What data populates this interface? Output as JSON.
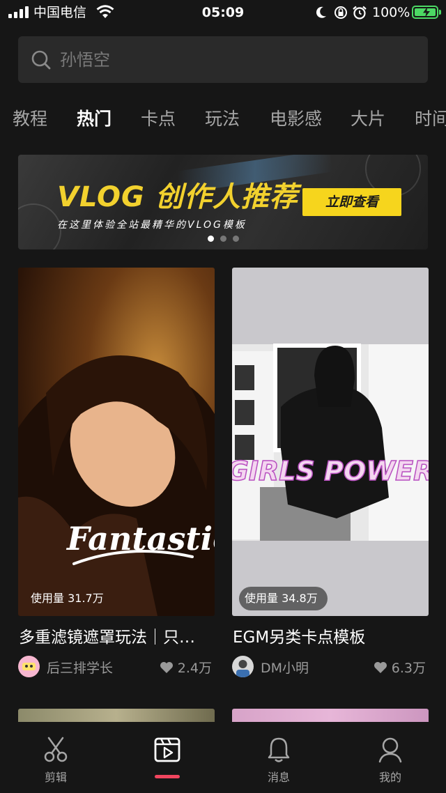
{
  "status_bar": {
    "carrier": "中国电信",
    "time": "05:09",
    "battery": "100%"
  },
  "search": {
    "placeholder": "孙悟空"
  },
  "tabs": [
    {
      "label": "教程",
      "active": false
    },
    {
      "label": "热门",
      "active": true
    },
    {
      "label": "卡点",
      "active": false
    },
    {
      "label": "玩法",
      "active": false
    },
    {
      "label": "电影感",
      "active": false
    },
    {
      "label": "大片",
      "active": false
    },
    {
      "label": "时间",
      "active": false
    }
  ],
  "banner": {
    "title": "VLOG 创作人推荐",
    "subtitle": "在这里体验全站最精华的VLOG模板",
    "button": "立即查看",
    "slides": 3,
    "active_slide": 1
  },
  "cards": [
    {
      "overlay_text": "Fantastic!",
      "usage": "使用量  31.7万",
      "title": "多重滤镜遮罩玩法｜只…",
      "author": "后三排学长",
      "likes": "2.4万"
    },
    {
      "overlay_text": "GIRLS POWER",
      "usage": "使用量  34.8万",
      "title": "EGM另类卡点模板",
      "author": "DM小明",
      "likes": "6.3万"
    }
  ],
  "bottom_nav": [
    {
      "label": "剪辑",
      "icon": "scissors-icon"
    },
    {
      "label": "",
      "icon": "template-icon",
      "active": true
    },
    {
      "label": "消息",
      "icon": "bell-icon"
    },
    {
      "label": "我的",
      "icon": "profile-icon"
    }
  ],
  "colors": {
    "background": "#161616",
    "accent": "#f0455e",
    "banner_yellow": "#f6d51d",
    "battery_green": "#4cd964"
  }
}
